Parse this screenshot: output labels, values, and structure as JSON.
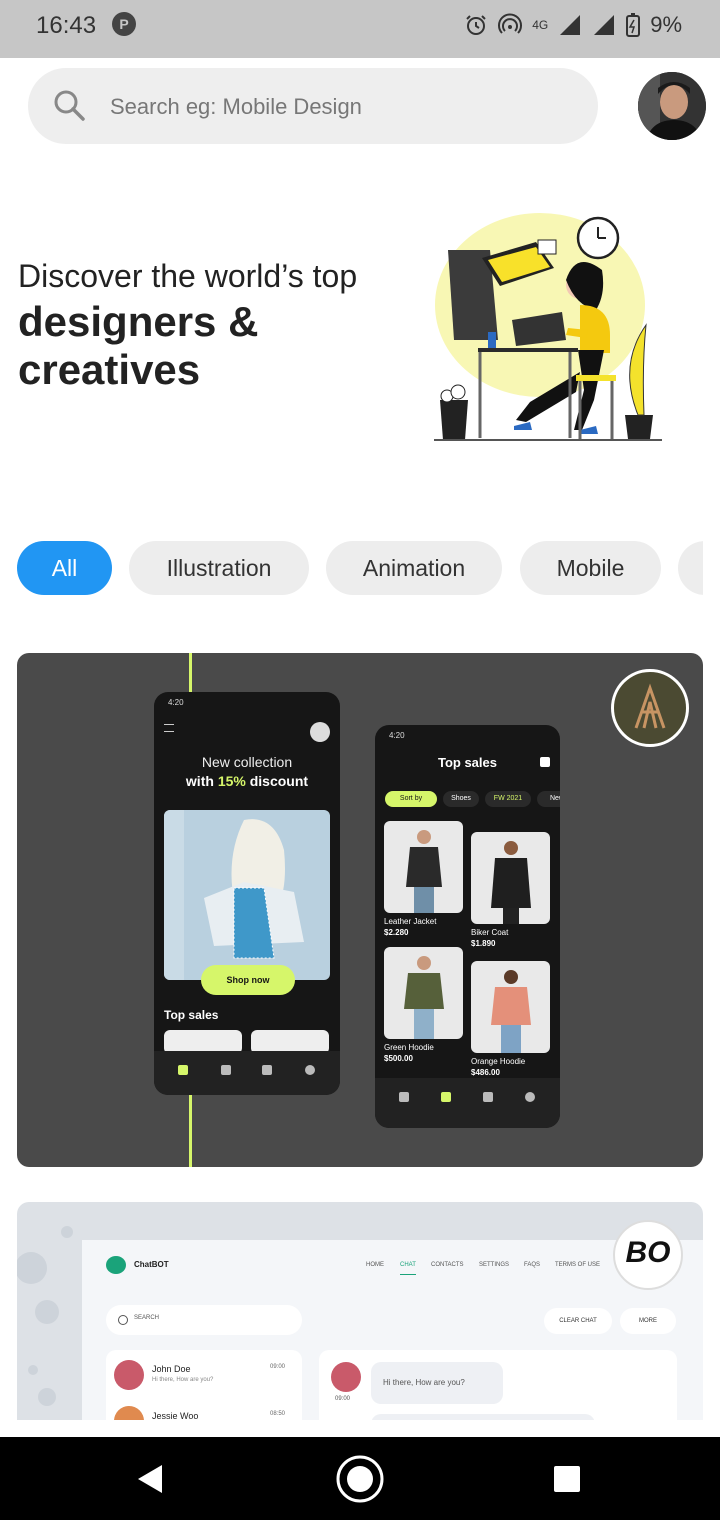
{
  "status": {
    "time": "16:43",
    "network": "4G",
    "battery": "9%"
  },
  "search": {
    "placeholder": "Search eg: Mobile Design"
  },
  "hero": {
    "line1": "Discover the world’s top",
    "line2": "designers &",
    "line3": "creatives"
  },
  "chips": [
    {
      "label": "All",
      "active": true
    },
    {
      "label": "Illustration",
      "active": false
    },
    {
      "label": "Animation",
      "active": false
    },
    {
      "label": "Mobile",
      "active": false
    }
  ],
  "shot1": {
    "left_phone": {
      "time": "4:20",
      "headline1": "New collection",
      "headline2_pre": "with ",
      "headline2_hl": "15%",
      "headline2_post": " discount",
      "cta": "Shop now",
      "section": "Top sales"
    },
    "right_phone": {
      "time": "4:20",
      "title": "Top sales",
      "tags": [
        "Sort by",
        "Shoes",
        "FW 2021",
        "New"
      ],
      "products": [
        {
          "name": "Leather Jacket",
          "price": "$2.280"
        },
        {
          "name": "Biker Coat",
          "price": "$1.890"
        },
        {
          "name": "Green Hoodie",
          "price": "$500.00"
        },
        {
          "name": "Orange Hoodie",
          "price": "$486.00"
        }
      ]
    }
  },
  "shot2": {
    "brand": "ChatBOT",
    "nav": [
      "HOME",
      "CHAT",
      "CONTACTS",
      "SETTINGS",
      "FAQS",
      "TERMS OF USE"
    ],
    "search": "SEARCH",
    "clear_chat": "CLEAR CHAT",
    "more": "MORE",
    "contacts": [
      {
        "name": "John Doe",
        "preview": "Hi there, How are you?",
        "time": "09:00"
      },
      {
        "name": "Jessie Woo",
        "preview": "",
        "time": "08:50"
      }
    ],
    "message": "Hi there, How are you?",
    "message_time": "09:00",
    "badge_text": "BO"
  },
  "colors": {
    "accent": "#2196f3",
    "lime": "#d6f66a",
    "chat_green": "#1aa37a"
  }
}
